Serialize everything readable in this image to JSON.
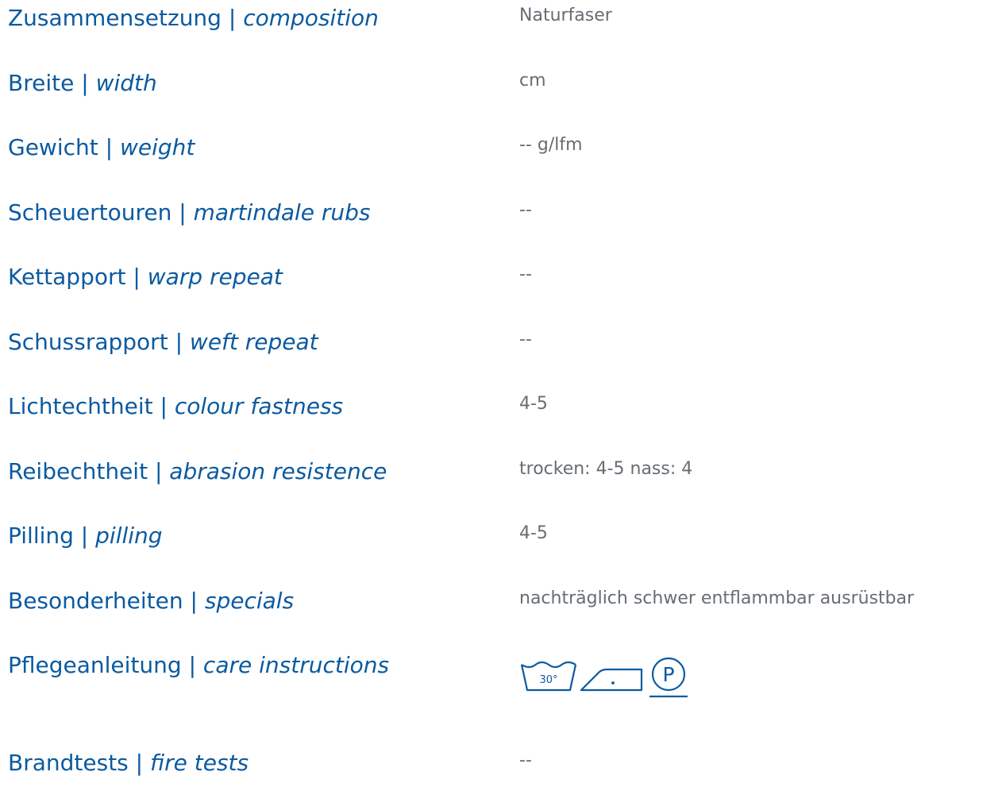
{
  "specs": [
    {
      "de": "Zusammensetzung",
      "en": "composition",
      "value": "Naturfaser"
    },
    {
      "de": "Breite",
      "en": "width",
      "value": "cm"
    },
    {
      "de": "Gewicht",
      "en": "weight",
      "value": "-- g/lfm"
    },
    {
      "de": "Scheuertouren",
      "en": "martindale rubs",
      "value": "--"
    },
    {
      "de": "Kettapport",
      "en": "warp repeat",
      "value": "--"
    },
    {
      "de": "Schussrapport",
      "en": "weft repeat",
      "value": "--"
    },
    {
      "de": "Lichtechtheit",
      "en": "colour fastness",
      "value": "4-5"
    },
    {
      "de": "Reibechtheit",
      "en": "abrasion resistence",
      "value": "trocken: 4-5 nass: 4"
    },
    {
      "de": "Pilling",
      "en": "pilling",
      "value": "4-5"
    },
    {
      "de": "Besonderheiten",
      "en": "specials",
      "value": "nachträglich schwer entflammbar ausrüstbar"
    },
    {
      "de": "Pflegeanleitung",
      "en": "care instructions",
      "value": ""
    },
    {
      "de": "Brandtests",
      "en": "fire tests",
      "value": "--"
    }
  ],
  "separator": " | ",
  "care_icons": {
    "wash": {
      "icon": "wash-30-icon",
      "text": "30°"
    },
    "iron": {
      "icon": "iron-low-icon"
    },
    "dry_clean": {
      "icon": "dry-clean-p-icon",
      "text": "P"
    }
  },
  "colors": {
    "label": "#0b5aa0",
    "value": "#666d74",
    "icon": "#0b5aa0"
  }
}
